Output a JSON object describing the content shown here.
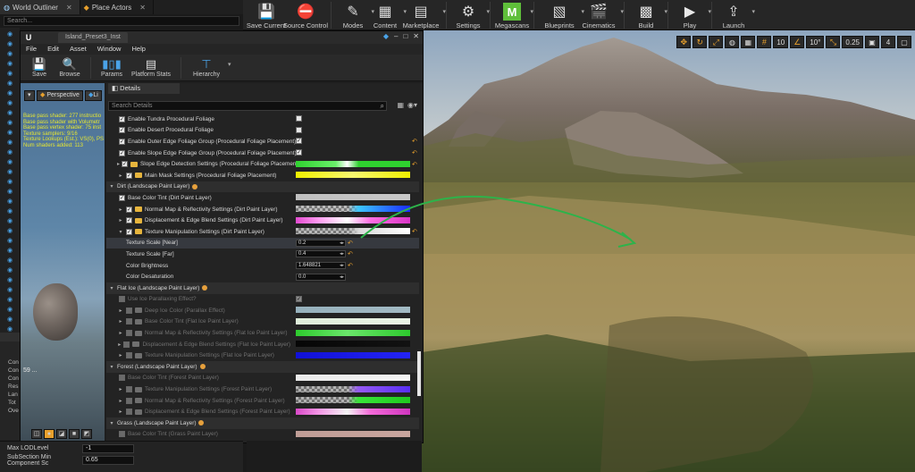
{
  "window_tabs": [
    {
      "label": "World Outliner",
      "active": true
    },
    {
      "label": "Place Actors",
      "active": false
    }
  ],
  "outliner": {
    "search_placeholder": "Search..."
  },
  "main_toolbar": [
    {
      "label": "Save Current",
      "icon": "save-icon"
    },
    {
      "label": "Source Control",
      "icon": "source-control-icon"
    },
    {
      "label": "Modes",
      "icon": "modes-icon"
    },
    {
      "label": "Content",
      "icon": "content-icon"
    },
    {
      "label": "Marketplace",
      "icon": "marketplace-icon"
    },
    {
      "label": "Settings",
      "icon": "gear-icon"
    },
    {
      "label": "Megascans",
      "icon": "megascans-icon"
    },
    {
      "label": "Blueprints",
      "icon": "blueprints-icon"
    },
    {
      "label": "Cinematics",
      "icon": "clapper-icon"
    },
    {
      "label": "Build",
      "icon": "build-icon"
    },
    {
      "label": "Play",
      "icon": "play-icon"
    },
    {
      "label": "Launch",
      "icon": "launch-icon"
    }
  ],
  "viewport_toolbar": {
    "grid": "10",
    "angle": "10°",
    "scale": "0.25",
    "camera_speed": "4"
  },
  "material_editor": {
    "title": "Island_Preset3_Inst",
    "menu": [
      "File",
      "Edit",
      "Asset",
      "Window",
      "Help"
    ],
    "toolbar": [
      {
        "label": "Save",
        "icon": "save-icon"
      },
      {
        "label": "Browse",
        "icon": "magnifier-icon"
      },
      {
        "label": "Params",
        "icon": "params-icon"
      },
      {
        "label": "Platform Stats",
        "icon": "stats-icon"
      },
      {
        "label": "Hierarchy",
        "icon": "hierarchy-icon"
      }
    ],
    "preview": {
      "mode_label": "Perspective",
      "lit_label": "Li",
      "stats": [
        "Base pass shader: 277 instructio",
        "Base pass shader with Volumetr",
        "Base pass vertex shader: 75 inst",
        "Texture samplers: 9/16",
        "Texture Lookups (Est.): VS(0), PS",
        "Num shaders added: 113"
      ],
      "count": "59 ..."
    },
    "details": {
      "tab_label": "Details",
      "search_placeholder": "Search Details",
      "rows": [
        {
          "type": "prop",
          "indent": 1,
          "label": "Enable Tundra Procedural Foliage",
          "checked": true,
          "val_type": "checkbox",
          "val_checked": false
        },
        {
          "type": "prop",
          "indent": 1,
          "label": "Enable Desert Procedural Foliage",
          "checked": true,
          "val_type": "checkbox",
          "val_checked": false
        },
        {
          "type": "prop",
          "indent": 1,
          "label": "Enable Outer Edge Foliage Group (Procedural Foliage Placement)",
          "checked": true,
          "val_type": "checkbox",
          "val_checked": true,
          "reset": true
        },
        {
          "type": "prop",
          "indent": 1,
          "label": "Enable Slope Edge Foliage Group (Procedural Foliage Placement)",
          "checked": true,
          "val_type": "checkbox",
          "val_checked": true,
          "reset": true
        },
        {
          "type": "group",
          "indent": 0,
          "label": "Slope Edge Detection Settings (Procedural Foliage Placement)",
          "checked": true,
          "val_type": "gradient",
          "gradient": "linear-gradient(90deg,#2fd12f 0%,#6af06a 35%,#ffffff 45%,#2fd12f 55%,#2fd12f 100%)",
          "reset": true
        },
        {
          "type": "group",
          "indent": 0,
          "label": "Main Mask Settings (Procedural Foliage Placement)",
          "checked": true,
          "val_type": "gradient",
          "gradient": "linear-gradient(90deg,#f0f000 0%,#f7f770 50%,#f0f000 100%)"
        },
        {
          "type": "category",
          "label": "Dirt (Landscape Paint Layer)"
        },
        {
          "type": "prop",
          "indent": 1,
          "label": "Base Color Tint (Dirt Paint Layer)",
          "checked": true,
          "val_type": "gradient",
          "gradient": "linear-gradient(90deg,#c0c0c0,#c8c8c8)"
        },
        {
          "type": "group",
          "indent": 0,
          "label": "Normal Map & Reflectivity Settings (Dirt Paint Layer)",
          "checked": true,
          "val_type": "gradient",
          "gradient": "linear-gradient(90deg,transparent 0%,transparent 46%,#3cc6ff 55%,#1a2bff 100%)",
          "checker": true
        },
        {
          "type": "group",
          "indent": 0,
          "label": "Displacement & Edge Blend Settings (Dirt Paint Layer)",
          "checked": true,
          "val_type": "gradient",
          "gradient": "linear-gradient(90deg,#e24bd0 0%,#ff9cf0 20%,#ffffff 45%,#ff6fe3 65%,#d936c7 100%)"
        },
        {
          "type": "group",
          "indent": 0,
          "open": true,
          "label": "Texture Manipulation Settings (Dirt Paint Layer)",
          "checked": true,
          "val_type": "gradient",
          "gradient": "linear-gradient(90deg,transparent 0%,transparent 46%,#d9d9d9 55%,#ffffff 100%)",
          "checker": true,
          "reset": true
        },
        {
          "type": "field",
          "label": "Texture Scale [Near]",
          "value": "0.2",
          "reset": true,
          "selected": true
        },
        {
          "type": "field",
          "label": "Texture Scale [Far]",
          "value": "0.4",
          "reset": true
        },
        {
          "type": "field",
          "label": "Color Brightness",
          "value": "1.648821",
          "reset": true
        },
        {
          "type": "field",
          "label": "Color Desaturation",
          "value": "0.0"
        },
        {
          "type": "category",
          "label": "Flat Ice (Landscape Paint Layer)"
        },
        {
          "type": "prop",
          "indent": 1,
          "dim": true,
          "label": "Use Ice Parallaxing Effect?",
          "checked": false,
          "val_type": "checkbox",
          "val_checked": true,
          "val_dim": true
        },
        {
          "type": "group",
          "indent": 0,
          "dim": true,
          "label": "Deep Ice Color (Parallax Effect)",
          "checked": false,
          "val_type": "gradient",
          "gradient": "linear-gradient(90deg,#9cb8c4,#a9c2cc)"
        },
        {
          "type": "group",
          "indent": 0,
          "dim": true,
          "label": "Base Color Tint (Flat Ice Paint Layer)",
          "checked": false,
          "val_type": "gradient",
          "gradient": "linear-gradient(90deg,#e9f8e4,#f4fff0)"
        },
        {
          "type": "group",
          "indent": 0,
          "dim": true,
          "label": "Normal Map & Reflectivity Settings (Flat Ice Paint Layer)",
          "checked": false,
          "val_type": "gradient",
          "gradient": "linear-gradient(90deg,#2ed32e 0%,#6ef06e 45%,#2ed32e 100%)"
        },
        {
          "type": "group",
          "indent": 0,
          "dim": true,
          "label": "Displacement & Edge Blend Settings (Flat Ice Paint Layer)",
          "checked": false,
          "val_type": "gradient",
          "gradient": "linear-gradient(90deg,#050505,#111111)"
        },
        {
          "type": "group",
          "indent": 0,
          "dim": true,
          "label": "Texture Manipulation Settings (Flat Ice Paint Layer)",
          "checked": false,
          "val_type": "gradient",
          "gradient": "linear-gradient(90deg,#1010e0,#2424ff)"
        },
        {
          "type": "category",
          "label": "Forest (Landscape Paint Layer)"
        },
        {
          "type": "prop",
          "indent": 1,
          "dim": true,
          "label": "Base Color Tint (Forest Paint Layer)",
          "checked": false,
          "val_type": "gradient",
          "gradient": "linear-gradient(90deg,#f4f4f4,#ffffff)"
        },
        {
          "type": "group",
          "indent": 0,
          "dim": true,
          "label": "Texture Manipulation Settings (Forest Paint Layer)",
          "checked": false,
          "val_type": "gradient",
          "gradient": "linear-gradient(90deg,transparent 0%,transparent 46%,#9c5cff 55%,#5a2fff 100%)",
          "checker": true
        },
        {
          "type": "group",
          "indent": 0,
          "dim": true,
          "label": "Normal Map & Reflectivity Settings (Forest Paint Layer)",
          "checked": false,
          "val_type": "gradient",
          "gradient": "linear-gradient(90deg,transparent 0%,transparent 46%,#3af03a 55%,#1fd31f 100%)",
          "checker": true
        },
        {
          "type": "group",
          "indent": 0,
          "dim": true,
          "label": "Displacement & Edge Blend Settings (Forest Paint Layer)",
          "checked": false,
          "val_type": "gradient",
          "gradient": "linear-gradient(90deg,#e24bd0 0%,#ff9cf0 20%,#ffffff 45%,#ff6fe3 65%,#d936c7 100%)"
        },
        {
          "type": "category",
          "label": "Grass (Landscape Paint Layer)"
        },
        {
          "type": "prop",
          "indent": 1,
          "dim": true,
          "label": "Base Color Tint (Grass Paint Layer)",
          "checked": false,
          "val_type": "gradient",
          "gradient": "linear-gradient(90deg,#c7a39c,#d1aca5)"
        }
      ]
    }
  },
  "lod": [
    {
      "label": "Max LODLevel",
      "value": "-1"
    },
    {
      "label": "SubSection Min Component Sc",
      "value": "0.65"
    }
  ],
  "left_labels": [
    "Con",
    "Con",
    "Con",
    "Res",
    "Lan",
    "Tot",
    "Ove"
  ],
  "colors": {
    "accent": "#e7a02d",
    "arrow": "#2db34a",
    "eye": "#4aa3e8"
  }
}
